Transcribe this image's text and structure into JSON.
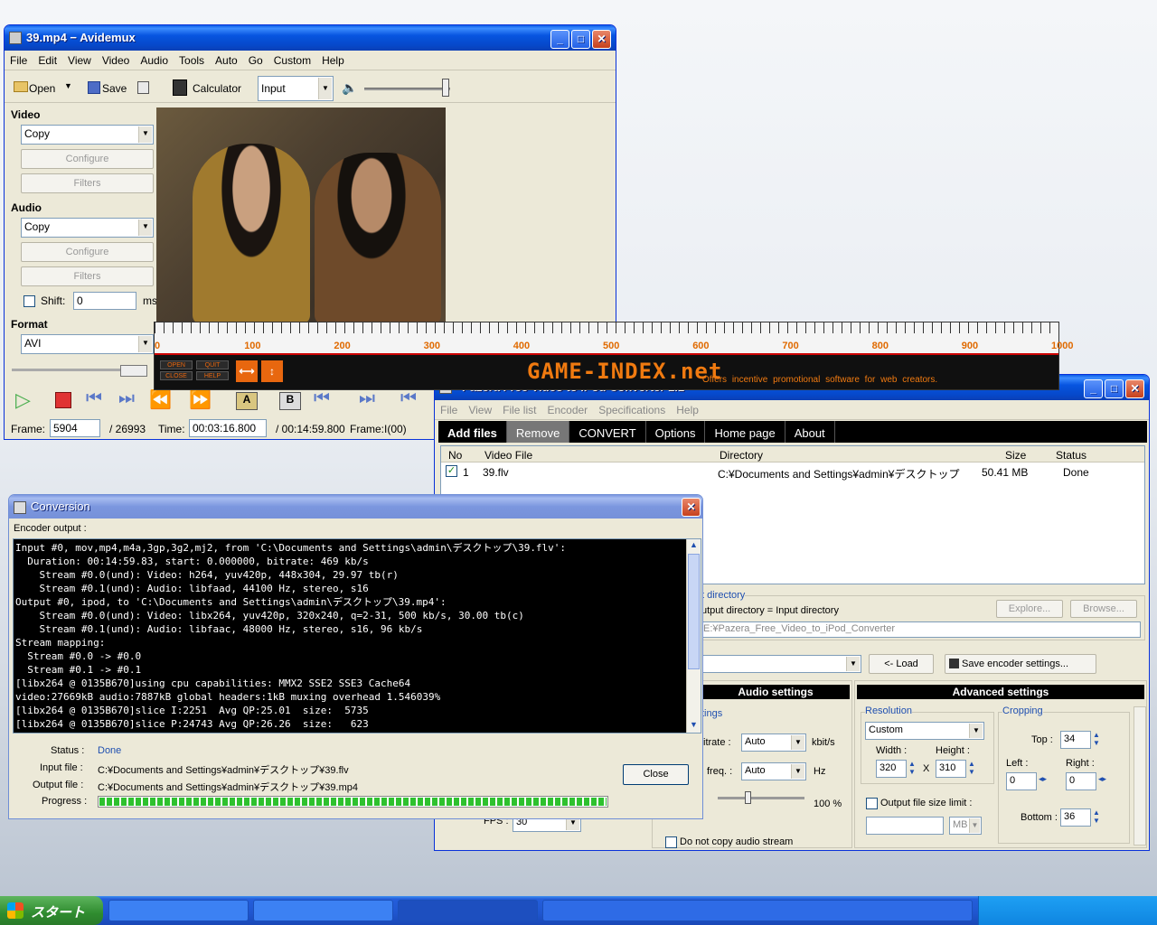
{
  "avidemux": {
    "title": "39.mp4 − Avidemux",
    "menu": [
      "File",
      "Edit",
      "View",
      "Video",
      "Audio",
      "Tools",
      "Auto",
      "Go",
      "Custom",
      "Help"
    ],
    "toolbar": {
      "open": "Open",
      "save": "Save",
      "calculator": "Calculator",
      "input_select": "Input"
    },
    "video_label": "Video",
    "video_codec": "Copy",
    "audio_label": "Audio",
    "audio_codec": "Copy",
    "configure": "Configure",
    "filters": "Filters",
    "shift_label": "Shift:",
    "shift_value": "0",
    "shift_unit": "ms",
    "format_label": "Format",
    "format_value": "AVI",
    "frame_label": "Frame:",
    "frame_value": "5904",
    "frame_total": "/ 26993",
    "time_label": "Time:",
    "time_value": "00:03:16.800",
    "time_total": "/ 00:14:59.800",
    "frame_type": "Frame:I(00)"
  },
  "banner": {
    "site": "GAME-INDEX.net",
    "tagline": "Offers incentive promotional software for web creators.",
    "ruler": [
      "0",
      "100",
      "200",
      "300",
      "400",
      "500",
      "600",
      "700",
      "800",
      "900",
      "1000"
    ],
    "btns": [
      "OPEN",
      "QUIT",
      "CLOSE",
      "HELP"
    ]
  },
  "pazera": {
    "title": "Pazera Free Video to iPod Converter 1.1",
    "menu": [
      "File",
      "View",
      "File list",
      "Encoder",
      "Specifications",
      "Help"
    ],
    "toolbar": [
      "Add files",
      "Remove",
      "CONVERT",
      "Options",
      "Home page",
      "About"
    ],
    "cols": {
      "no": "No",
      "file": "Video File",
      "dir": "Directory",
      "size": "Size",
      "status": "Status"
    },
    "row": {
      "no": "1",
      "file": "39.flv",
      "dir": "C:¥Documents and Settings¥admin¥デスクトップ",
      "size": "50.41 MB",
      "status": "Done"
    },
    "outdir_group": "t directory",
    "outdir_opt": "utput directory = Input directory",
    "explore": "Explore...",
    "browse": "Browse...",
    "outdir_path": "E:¥Pazera_Free_Video_to_iPod_Converter",
    "load": "<- Load",
    "save_enc": "Save encoder settings...",
    "audio_settings": "Audio settings",
    "advanced_settings": "Advanced settings",
    "tings": "tings",
    "bitrate": "itrate :",
    "bitrate_val": "Auto",
    "bitrate_unit": "kbit/s",
    "freq": "freq. :",
    "freq_val": "Auto",
    "freq_unit": "Hz",
    "volume": "100 %",
    "nocopy": "Do not copy audio stream",
    "fps": "FPS :",
    "fps_val": "30",
    "resolution": "Resolution",
    "res_val": "Custom",
    "width_label": "Width :",
    "width_val": "320",
    "height_label": "Height :",
    "height_val": "310",
    "x": "X",
    "cropping": "Cropping",
    "top_label": "Top :",
    "top_val": "34",
    "left_label": "Left :",
    "left_val": "0",
    "right_label": "Right :",
    "right_val": "0",
    "bottom_label": "Bottom :",
    "bottom_val": "36",
    "size_limit": "Output file size limit :",
    "mb": "MB"
  },
  "conversion": {
    "title": "Conversion",
    "encoder_output": "Encoder output :",
    "log": [
      "Input #0, mov,mp4,m4a,3gp,3g2,mj2, from 'C:\\Documents and Settings\\admin\\デスクトップ\\39.flv':",
      "  Duration: 00:14:59.83, start: 0.000000, bitrate: 469 kb/s",
      "    Stream #0.0(und): Video: h264, yuv420p, 448x304, 29.97 tb(r)",
      "    Stream #0.1(und): Audio: libfaad, 44100 Hz, stereo, s16",
      "Output #0, ipod, to 'C:\\Documents and Settings\\admin\\デスクトップ\\39.mp4':",
      "    Stream #0.0(und): Video: libx264, yuv420p, 320x240, q=2-31, 500 kb/s, 30.00 tb(c)",
      "    Stream #0.1(und): Audio: libfaac, 48000 Hz, stereo, s16, 96 kb/s",
      "Stream mapping:",
      "  Stream #0.0 -> #0.0",
      "  Stream #0.1 -> #0.1",
      "[libx264 @ 0135B670]using cpu capabilities: MMX2 SSE2 SSE3 Cache64",
      "video:27669kB audio:7887kB global headers:1kB muxing overhead 1.546039%",
      "[libx264 @ 0135B670]slice I:2251  Avg QP:25.01  size:  5735",
      "[libx264 @ 0135B670]slice P:24743 Avg QP:26.26  size:   623"
    ],
    "status_label": "Status :",
    "status_val": "Done",
    "input_label": "Input file :",
    "input_val": "C:¥Documents and Settings¥admin¥デスクトップ¥39.flv",
    "output_label": "Output file :",
    "output_val": "C:¥Documents and Settings¥admin¥デスクトップ¥39.mp4",
    "progress_label": "Progress :",
    "progress": 1.0,
    "close": "Close"
  },
  "taskbar": {
    "start": "スタート"
  }
}
